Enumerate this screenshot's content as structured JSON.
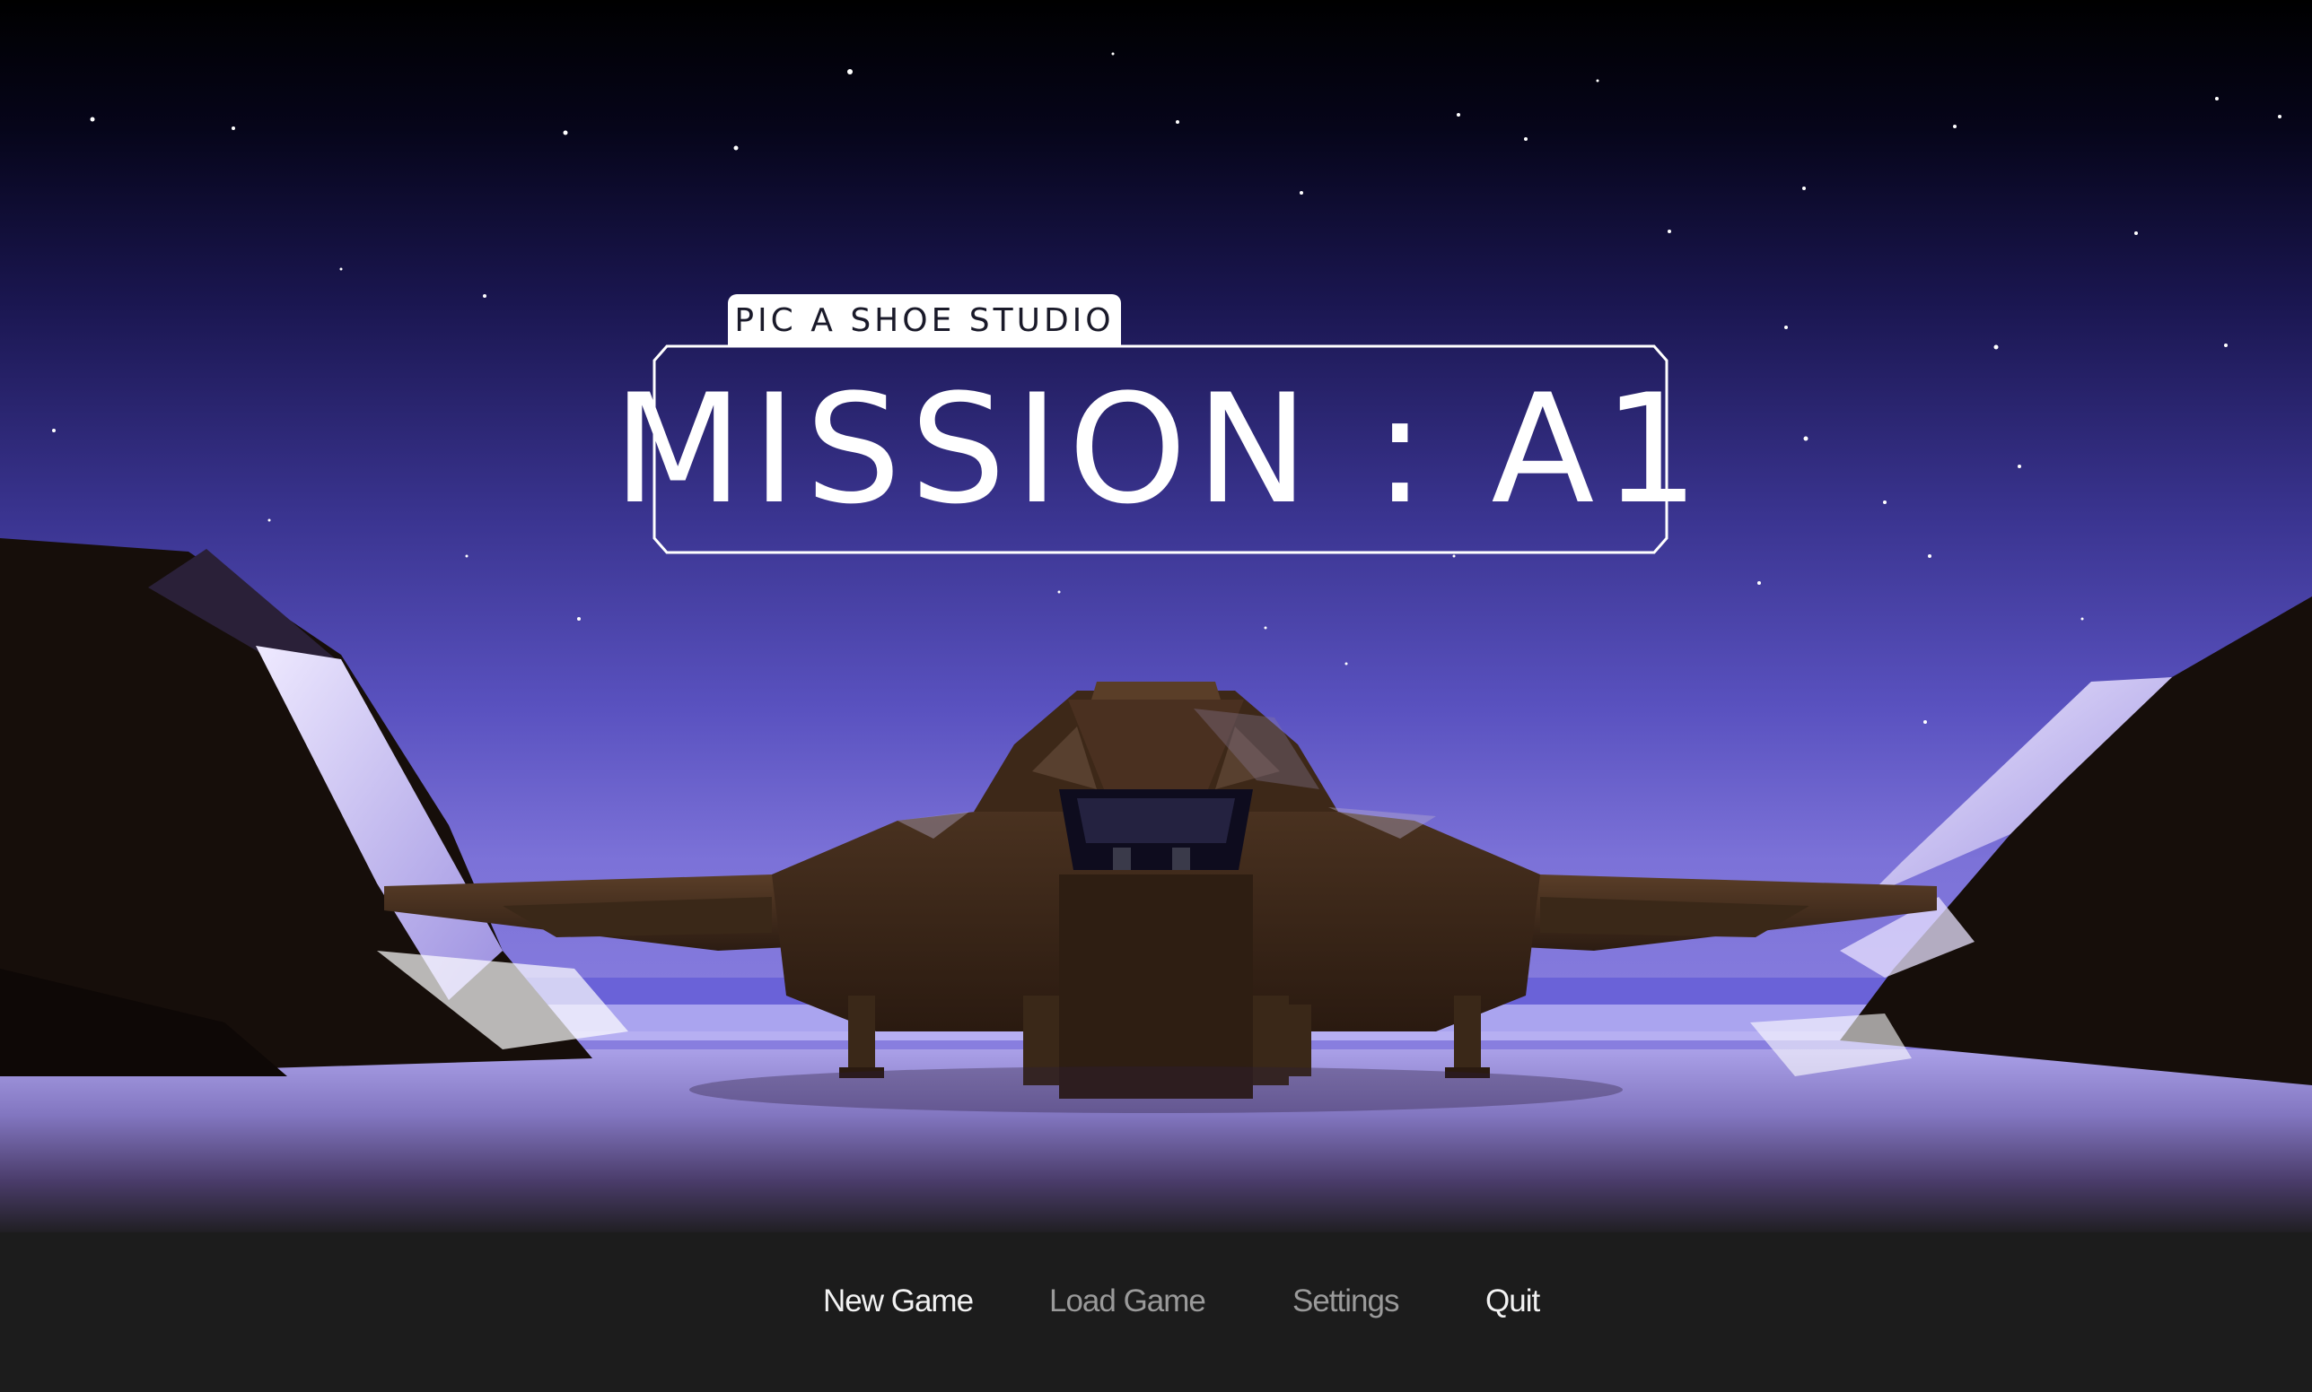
{
  "game": {
    "studio_name": "PIC A SHOE STUDIO",
    "title": "MISSION : A1"
  },
  "menu": {
    "items": [
      {
        "label": "New Game",
        "state": "enabled"
      },
      {
        "label": "Load Game",
        "state": "disabled"
      },
      {
        "label": "Settings",
        "state": "disabled"
      },
      {
        "label": "Quit",
        "state": "enabled"
      }
    ]
  },
  "colors": {
    "sky_top": "#000000",
    "sky_mid": "#3a3490",
    "sky_horizon": "#7c72d8",
    "ground": "#8c82c8",
    "ship_hull": "#3a2618",
    "menu_bar": "#1c1c1c",
    "menu_active": "#f2f2f2",
    "menu_inactive": "#9a9a9a"
  }
}
